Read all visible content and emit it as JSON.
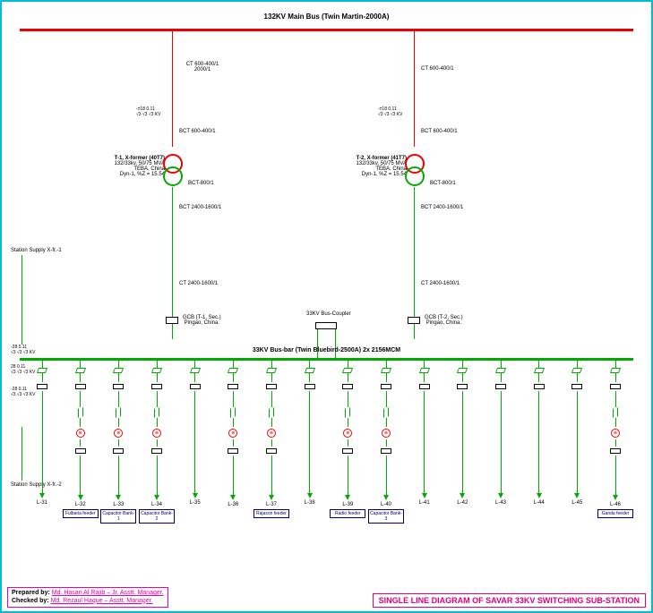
{
  "title_main": "132KV Main Bus (Twin Martin-2000A)",
  "bus33_label": "33KV Bus-bar (Twin Bluebird-2500A) 2x 2156MCM",
  "coupler_label": "33KV Bus-Coupler",
  "station_supply1": "Station Supply X-fr.-1",
  "station_supply2": "Station Supply X-fr.-2",
  "transformers": [
    {
      "name": "T-1, X-former (40T7)",
      "spec": "132/33kv, 50/75 MVA",
      "maker": "TEBA, China",
      "imp": "Dyn-1, %Z = 15.54",
      "ct_top": "CT\n600-400/1\n2000/1",
      "bct_mid": "BCT\n600-400/1",
      "bct_sec": "BCT-800/1",
      "bct_bot": "BCT\n2400-1600/1",
      "ct_bot": "CT\n2400-1600/1",
      "gcb": "GCB (T-1, Sec.)\nPingao, China."
    },
    {
      "name": "T-2, X-former (41T7)",
      "spec": "132/33kv, 50/75 MVA",
      "maker": "TEBA, China",
      "imp": "Dyn-1, %Z = 15.54",
      "ct_top": "CT\n600-400/1",
      "bct_mid": "BCT\n600-400/1",
      "bct_sec": "BCT-800/1",
      "bct_bot": "BCT\n2400-1600/1",
      "ct_bot": "CT\n2400-1600/1",
      "gcb": "GCB (T-2, Sec.)\nPingao, China."
    }
  ],
  "feeders": [
    {
      "label": "L-31",
      "named": ""
    },
    {
      "label": "L-32",
      "named": "Fulbaria feeder"
    },
    {
      "label": "L-33",
      "named": "Capacitor Bank-1"
    },
    {
      "label": "L-34",
      "named": "Capacitor Bank-2"
    },
    {
      "label": "L-35",
      "named": ""
    },
    {
      "label": "L-36",
      "named": ""
    },
    {
      "label": "L-37",
      "named": "Rajason feeder"
    },
    {
      "label": "L-38",
      "named": ""
    },
    {
      "label": "L-39",
      "named": "Radio feeder"
    },
    {
      "label": "L-40",
      "named": "Capacitor Bank-3"
    },
    {
      "label": "L-41",
      "named": ""
    },
    {
      "label": "L-42",
      "named": ""
    },
    {
      "label": "L-43",
      "named": ""
    },
    {
      "label": "L-44",
      "named": ""
    },
    {
      "label": "L-45",
      "named": ""
    },
    {
      "label": "L-46",
      "named": "Ganda feeder"
    }
  ],
  "detailed_feeders": [
    1,
    2,
    3,
    5,
    6,
    8,
    9,
    15
  ],
  "credits": {
    "prepared_label": "Prepared by:",
    "prepared_val": "Md. Hasan Al Rajib – Jr. Asstt. Manager.",
    "checked_label": "Checked by:",
    "checked_val": "Md. Rezaul Haque – Asstt. Manager."
  },
  "footer_title": "SINGLE LINE DIAGRAM OF SAVAR 33KV SWITCHING SUB-STATION",
  "relay_text": "⊗"
}
